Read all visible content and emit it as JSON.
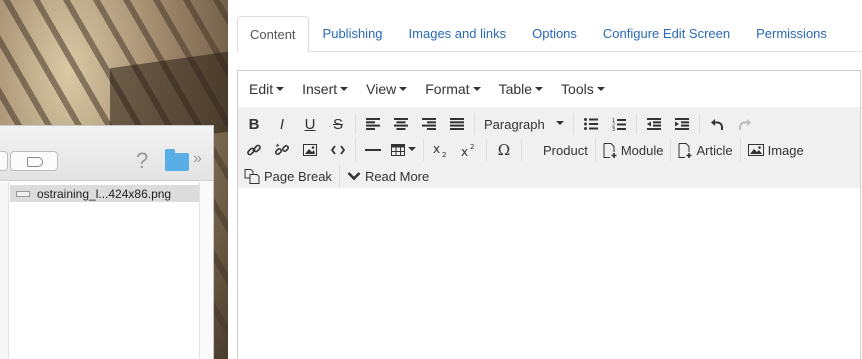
{
  "finder": {
    "help_glyph": "?",
    "more_glyph": "»",
    "files": [
      {
        "name": "ostraining_l...424x86.png"
      }
    ]
  },
  "tabs": [
    {
      "label": "Content",
      "active": true
    },
    {
      "label": "Publishing"
    },
    {
      "label": "Images and links"
    },
    {
      "label": "Options"
    },
    {
      "label": "Configure Edit Screen"
    },
    {
      "label": "Permissions"
    }
  ],
  "menubar": [
    "Edit",
    "Insert",
    "View",
    "Format",
    "Table",
    "Tools"
  ],
  "toolbar": {
    "bold": "B",
    "italic": "I",
    "underline": "U",
    "strike": "S",
    "format_select": "Paragraph",
    "omega": "Ω",
    "product": "Product",
    "module": "Module",
    "article": "Article",
    "image": "Image",
    "page_break": "Page Break",
    "read_more": "Read More"
  },
  "colors": {
    "link": "#2a69b8",
    "toolbar_bg": "#f0f0f0"
  }
}
